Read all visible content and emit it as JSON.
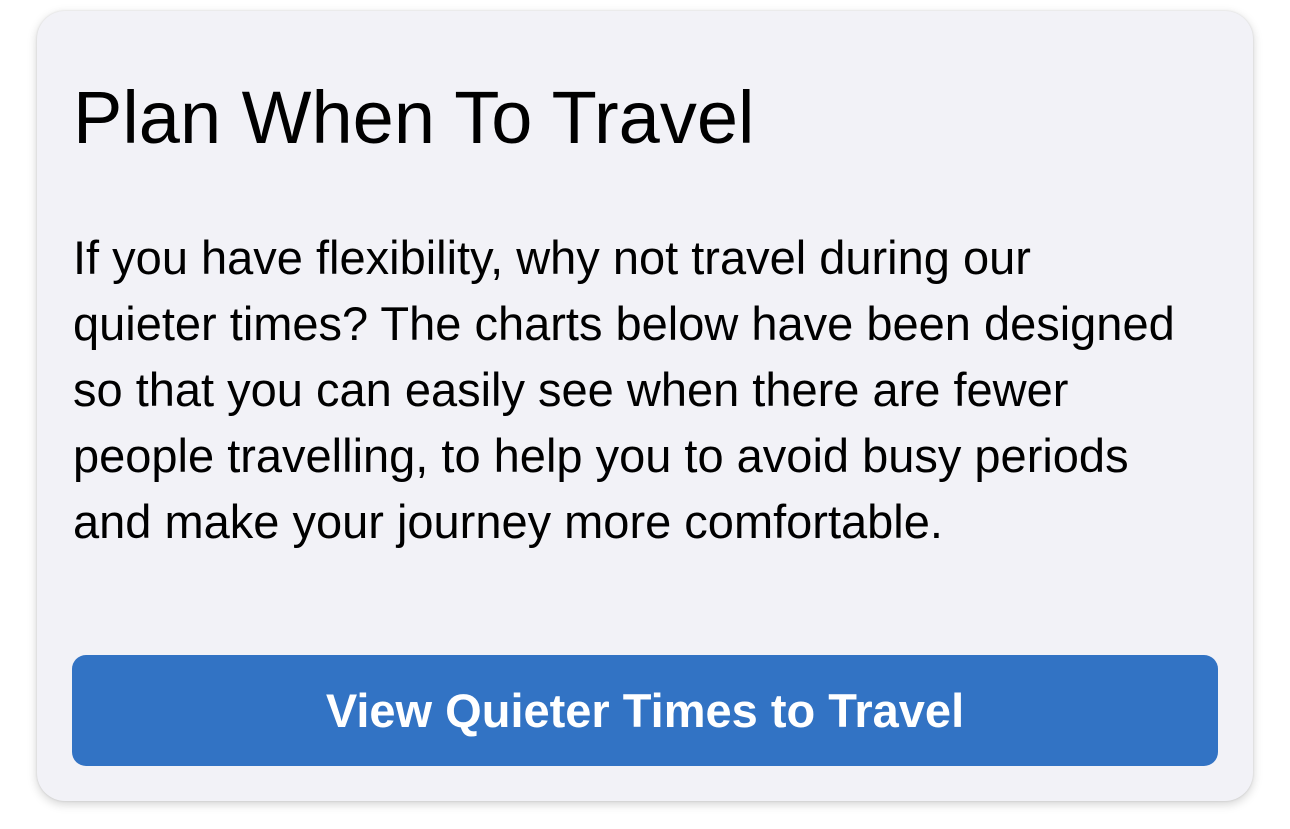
{
  "card": {
    "title": "Plan When To Travel",
    "body": "If you have flexibility, why not travel during our quieter times? The charts below have been designed so that you can easily see when there are fewer people travelling, to help you to avoid busy periods and make your journey more comfortable.",
    "button_label": "View Quieter Times to Travel"
  },
  "colors": {
    "card_background": "#f2f2f7",
    "button_background": "#3273c4",
    "button_text": "#ffffff",
    "text": "#000000"
  }
}
